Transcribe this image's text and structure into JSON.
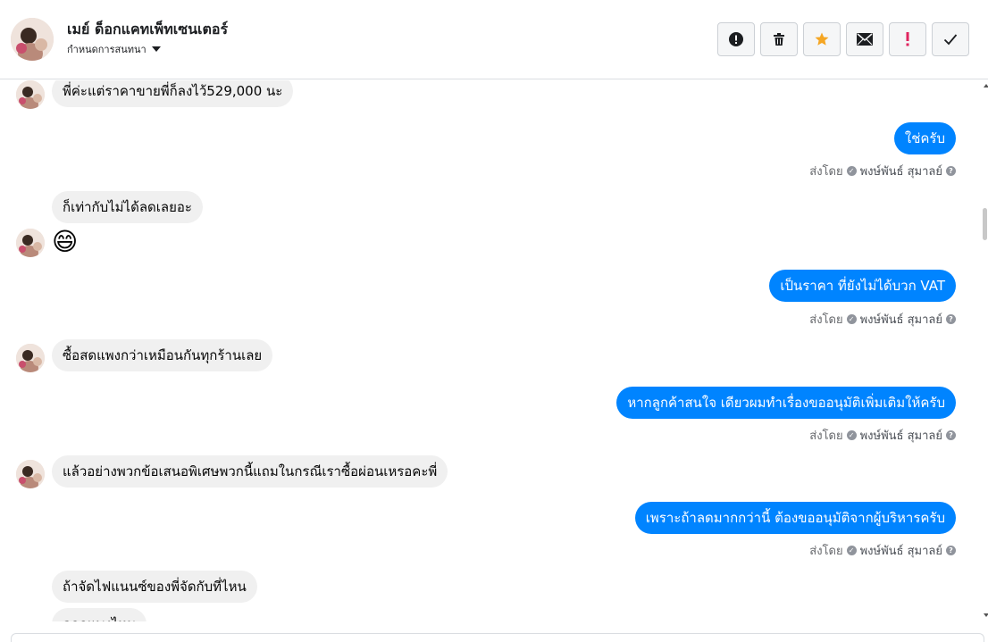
{
  "header": {
    "contact_name": "เมย์ ด็อกแคทเพ็ทเซนเตอร์",
    "subtitle": "กำหนดการสนทนา",
    "toolbar": [
      {
        "name": "spam-report-button",
        "icon": "alert-circle-icon"
      },
      {
        "name": "delete-button",
        "icon": "trash-icon"
      },
      {
        "name": "star-button",
        "icon": "star-icon",
        "color": "#f5a623"
      },
      {
        "name": "mark-unread-button",
        "icon": "envelope-icon"
      },
      {
        "name": "mark-important-button",
        "icon": "exclamation-icon",
        "color": "#e0245e"
      },
      {
        "name": "mark-done-button",
        "icon": "check-icon"
      }
    ]
  },
  "colors": {
    "outgoing_bubble": "#0084ff",
    "incoming_bubble": "#f0f0f0"
  },
  "sent_by": {
    "prefix": "ส่งโดย",
    "name": "พงษ์พันธ์ สุมาลย์"
  },
  "messages": [
    {
      "dir": "in",
      "text": "พี่ค่ะแต่ราคาขายพี่ก็ลงไว้529,000 นะ"
    },
    {
      "dir": "out",
      "text": "ใช่ครับ"
    },
    {
      "dir": "in",
      "text": "ก็เท่ากับไม่ได้ลดเลยอะ"
    },
    {
      "dir": "in",
      "text": "😄"
    },
    {
      "dir": "out",
      "text": "เป็นราคา ที่ยังไม่ได้บวก VAT"
    },
    {
      "dir": "in",
      "text": "ซื้อสดแพงกว่าเหมือนกันทุกร้านเลย"
    },
    {
      "dir": "out",
      "text": "หากลูกค้าสนใจ เดียวผมทำเรื่องขออนุมัติเพิ่มเติมให้ครับ"
    },
    {
      "dir": "in",
      "text": "แล้วอย่างพวกข้อเสนอพิเศษพวกนี้แถมในกรณีเราซื้อผ่อนเหรอคะพี่"
    },
    {
      "dir": "out",
      "text": "เพราะถ้าลดมากกว่านี้ ต้องขออนุมัติจากผู้บริหารครับ"
    },
    {
      "dir": "in",
      "text": "ถ้าจัดไฟแนนซ์ของพี่จัดกับที่ไหน"
    },
    {
      "dir": "in",
      "text": "ดอกแพงไหม"
    }
  ]
}
